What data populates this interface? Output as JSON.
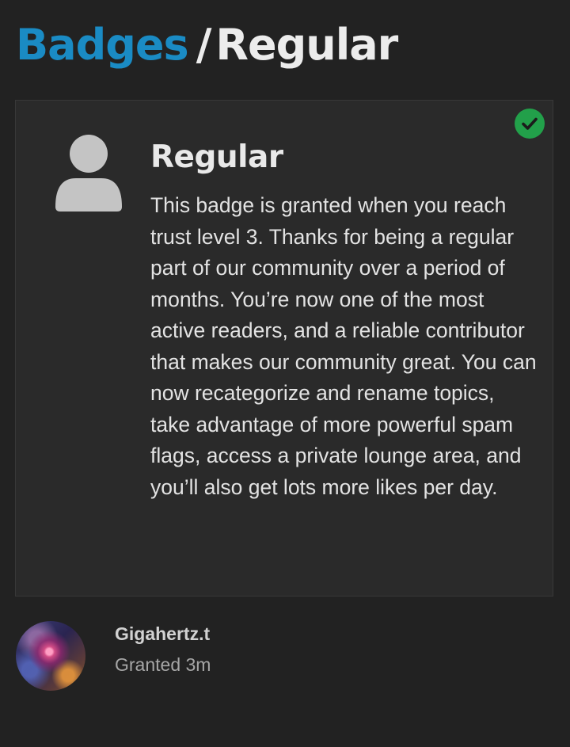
{
  "colors": {
    "accent": "#1a8bc4",
    "success": "#22a04a"
  },
  "breadcrumb": {
    "root_label": "Badges",
    "separator": "/",
    "current_label": "Regular"
  },
  "badge": {
    "icon": "user-icon",
    "status_icon": "check-circle-icon",
    "title": "Regular",
    "description": "This badge is granted when you reach trust level 3. Thanks for being a regular part of our community over a period of months. You’re now one of the most active readers, and a reliable contributor that makes our community great. You can now recategorize and rename topics, take advantage of more powerful spam flags, access a private lounge area, and you’ll also get lots more likes per day."
  },
  "grant": {
    "username": "Gigahertz.t",
    "granted_text": "Granted 3m"
  }
}
